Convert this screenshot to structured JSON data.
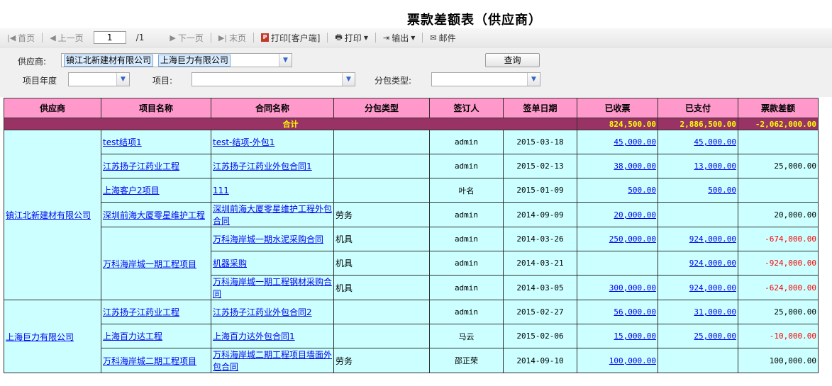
{
  "page": {
    "title": "票款差额表（供应商）"
  },
  "toolbar": {
    "first": "首页",
    "prev": "上一页",
    "page_value": "1",
    "total": "/1",
    "next": "下一页",
    "last": "末页",
    "print_client": "打印[客户端]",
    "print": "打印",
    "export": "输出",
    "mail": "邮件"
  },
  "filters": {
    "supplier_label": "供应商:",
    "supplier_tags": [
      "镇江北新建材有限公司",
      "上海巨力有限公司"
    ],
    "year_label": "项目年度",
    "project_label": "项目:",
    "subcontract_label": "分包类型:",
    "query": "查询"
  },
  "table": {
    "headers": [
      "供应商",
      "项目名称",
      "合同名称",
      "分包类型",
      "签订人",
      "签单日期",
      "已收票",
      "已支付",
      "票款差额"
    ],
    "sum": {
      "label": "合计",
      "received": "824,500.00",
      "paid": "2,886,500.00",
      "diff": "-2,062,000.00"
    },
    "groups": [
      {
        "supplier": "镇江北新建材有限公司",
        "projects": [
          {
            "name": "test结项1",
            "contracts": [
              {
                "name": "test-结项-外包1",
                "type": "",
                "signer": "admin",
                "date": "2015-03-18",
                "received": "45,000.00",
                "paid": "45,000.00",
                "diff": ""
              }
            ]
          },
          {
            "name": "江苏扬子江药业工程",
            "contracts": [
              {
                "name": "江苏扬子江药业外包合同1",
                "type": "",
                "signer": "admin",
                "date": "2015-02-13",
                "received": "38,000.00",
                "paid": "13,000.00",
                "diff": "25,000.00"
              }
            ]
          },
          {
            "name": "上海客户2项目",
            "contracts": [
              {
                "name": "111",
                "type": "",
                "signer": "叶名",
                "date": "2015-01-09",
                "received": "500.00",
                "paid": "500.00",
                "diff": ""
              }
            ]
          },
          {
            "name": "深圳前海大厦零星维护工程",
            "contracts": [
              {
                "name": "深圳前海大厦零星维护工程外包合同",
                "type": "劳务",
                "signer": "admin",
                "date": "2014-09-09",
                "received": "20,000.00",
                "paid": "",
                "diff": "20,000.00"
              }
            ]
          },
          {
            "name": "万科海岸城一期工程项目",
            "contracts": [
              {
                "name": "万科海岸城一期水泥采购合同",
                "type": "机具",
                "signer": "admin",
                "date": "2014-03-26",
                "received": "250,000.00",
                "paid": "924,000.00",
                "diff": "-674,000.00"
              },
              {
                "name": "机器采购",
                "type": "机具",
                "signer": "admin",
                "date": "2014-03-21",
                "received": "",
                "paid": "924,000.00",
                "diff": "-924,000.00"
              },
              {
                "name": "万科海岸城一期工程钢材采购合同",
                "type": "机具",
                "signer": "admin",
                "date": "2014-03-05",
                "received": "300,000.00",
                "paid": "924,000.00",
                "diff": "-624,000.00"
              }
            ]
          }
        ]
      },
      {
        "supplier": "上海巨力有限公司",
        "projects": [
          {
            "name": "江苏扬子江药业工程",
            "contracts": [
              {
                "name": "江苏扬子江药业外包合同2",
                "type": "",
                "signer": "admin",
                "date": "2015-02-27",
                "received": "56,000.00",
                "paid": "31,000.00",
                "diff": "25,000.00"
              }
            ]
          },
          {
            "name": "上海百力达工程",
            "contracts": [
              {
                "name": "上海百力达外包合同1",
                "type": "",
                "signer": "马云",
                "date": "2015-02-06",
                "received": "15,000.00",
                "paid": "25,000.00",
                "diff": "-10,000.00"
              }
            ]
          },
          {
            "name": "万科海岸城二期工程项目",
            "contracts": [
              {
                "name": "万科海岸城二期工程项目墙面外包合同",
                "type": "劳务",
                "signer": "邵正荣",
                "date": "2014-09-10",
                "received": "100,000.00",
                "paid": "",
                "diff": "100,000.00"
              }
            ]
          }
        ]
      }
    ]
  },
  "colors": {
    "header_bg": "#ff99cc",
    "sum_bg": "#993366",
    "sum_text": "#ffff00",
    "row_bg": "#ccffff",
    "link": "#0000ee",
    "negative": "#ff0000"
  },
  "icons": {
    "first": "first-page-icon",
    "prev": "prev-page-icon",
    "next": "next-page-icon",
    "last": "last-page-icon",
    "pdf": "pdf-icon",
    "print": "printer-icon",
    "export": "export-icon",
    "mail": "mail-icon"
  }
}
